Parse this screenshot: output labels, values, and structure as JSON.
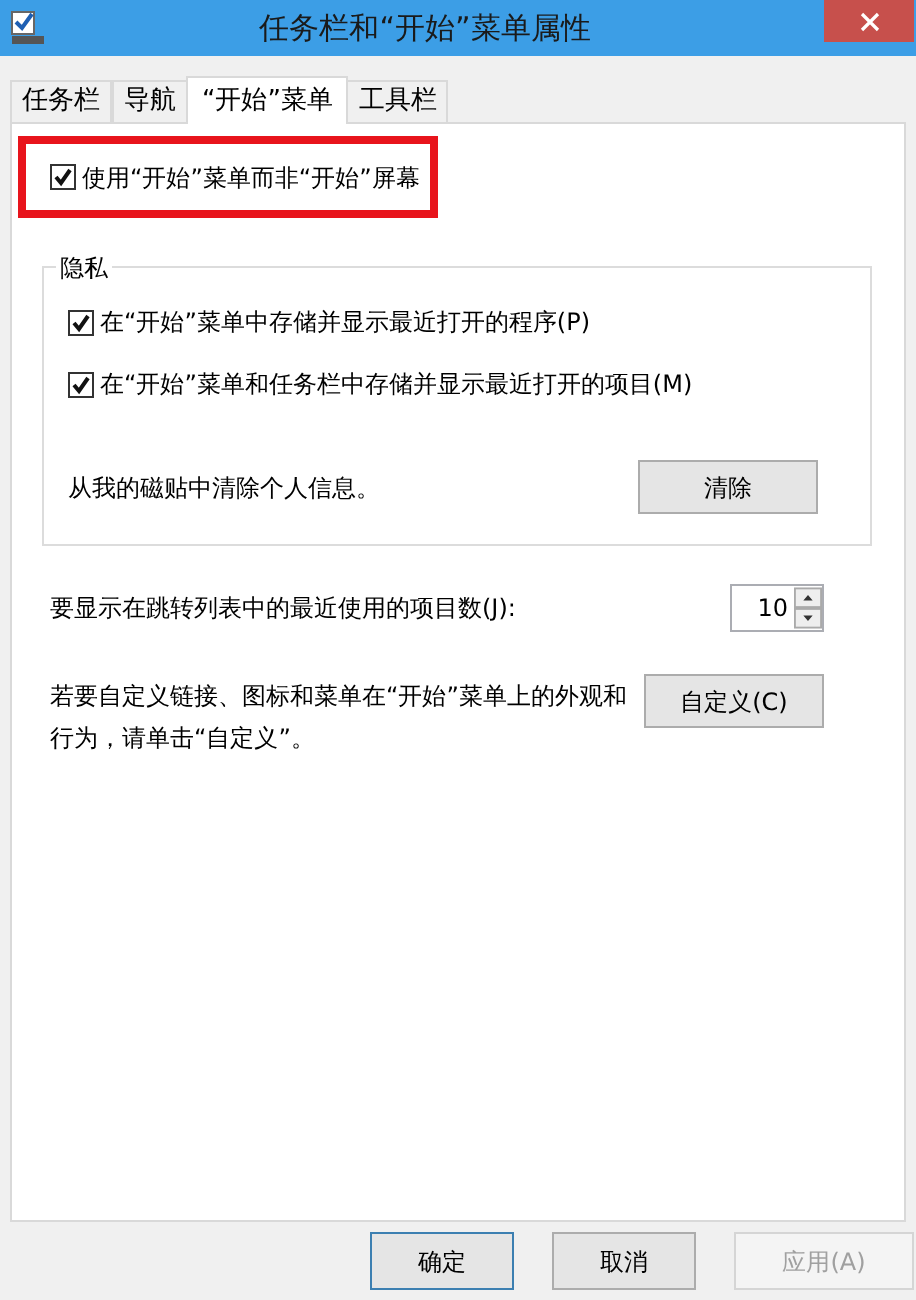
{
  "window": {
    "title": "任务栏和“开始”菜单属性"
  },
  "tabs": [
    {
      "label": "任务栏",
      "selected": false
    },
    {
      "label": "导航",
      "selected": false
    },
    {
      "label": "“开始”菜单",
      "selected": true
    },
    {
      "label": "工具栏",
      "selected": false
    }
  ],
  "main_option": {
    "label": "使用“开始”菜单而非“开始”屏幕",
    "checked": true,
    "highlighted": true
  },
  "privacy": {
    "title": "隐私",
    "options": [
      {
        "label": "在“开始”菜单中存储并显示最近打开的程序(P)",
        "checked": true
      },
      {
        "label": "在“开始”菜单和任务栏中存储并显示最近打开的项目(M)",
        "checked": true
      }
    ],
    "clear_text": "从我的磁贴中清除个人信息。",
    "clear_button": "清除"
  },
  "recent_items": {
    "label": "要显示在跳转列表中的最近使用的项目数(J):",
    "value": "10"
  },
  "customize": {
    "text": "若要自定义链接、图标和菜单在“开始”菜单上的外观和行为，请单击“自定义”。",
    "button": "自定义(C)"
  },
  "buttons": [
    {
      "label": "确定",
      "disabled": false,
      "default": true
    },
    {
      "label": "取消",
      "disabled": false,
      "default": false
    },
    {
      "label": "应用(A)",
      "disabled": true,
      "default": false
    }
  ]
}
